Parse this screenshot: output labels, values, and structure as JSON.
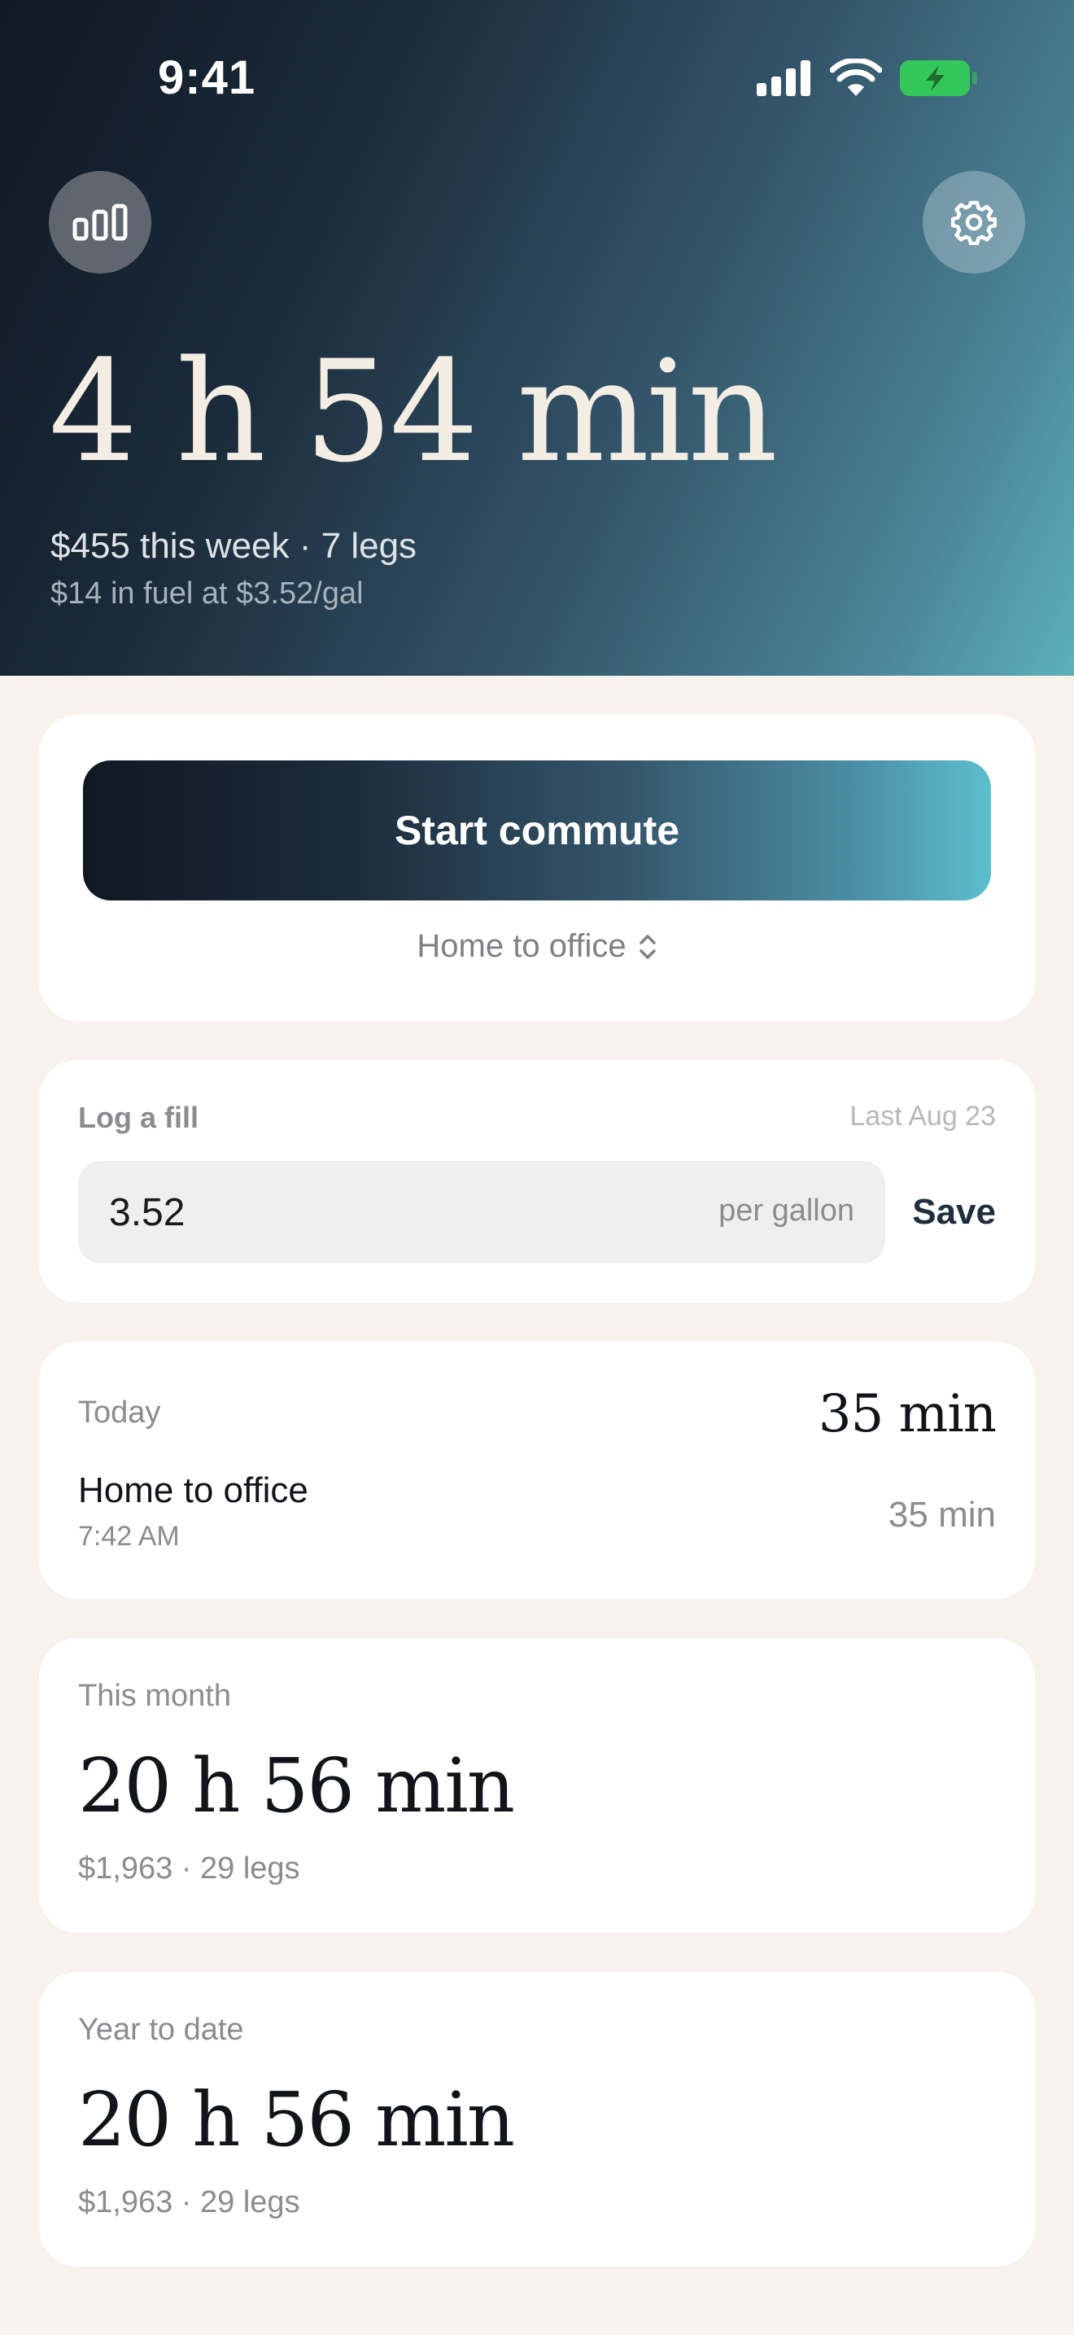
{
  "status_bar": {
    "time": "9:41",
    "icons": [
      "cellular-signal-icon",
      "wifi-icon",
      "battery-charging-icon"
    ],
    "battery_color": "#34c759"
  },
  "header": {
    "stats_icon": "bar-chart-icon",
    "settings_icon": "gear-icon",
    "week_total": "4 h 54 min",
    "week_summary": "$455 this week · 7 legs",
    "fuel_summary": "$14 in fuel at $3.52/gal"
  },
  "commute": {
    "start_label": "Start commute",
    "route_label": "Home to office",
    "route_icon": "chevron-up-down-icon"
  },
  "fill": {
    "label": "Log a fill",
    "last": "Last Aug 23",
    "value": "3.52",
    "unit": "per gallon",
    "save_label": "Save"
  },
  "today": {
    "label": "Today",
    "total": "35 min",
    "trips": [
      {
        "name": "Home to office",
        "time": "7:42 AM",
        "duration": "35 min"
      }
    ]
  },
  "month": {
    "label": "This month",
    "total": "20 h 56 min",
    "summary": "$1,963 · 29 legs"
  },
  "year": {
    "label": "Year to date",
    "total": "20 h 56 min",
    "summary": "$1,963 · 29 legs"
  },
  "colors": {
    "background": "#f7f3ec",
    "gradient_dark": "#0f1823",
    "gradient_light": "#5cb0bc",
    "save_text": "#1e2e3c"
  }
}
